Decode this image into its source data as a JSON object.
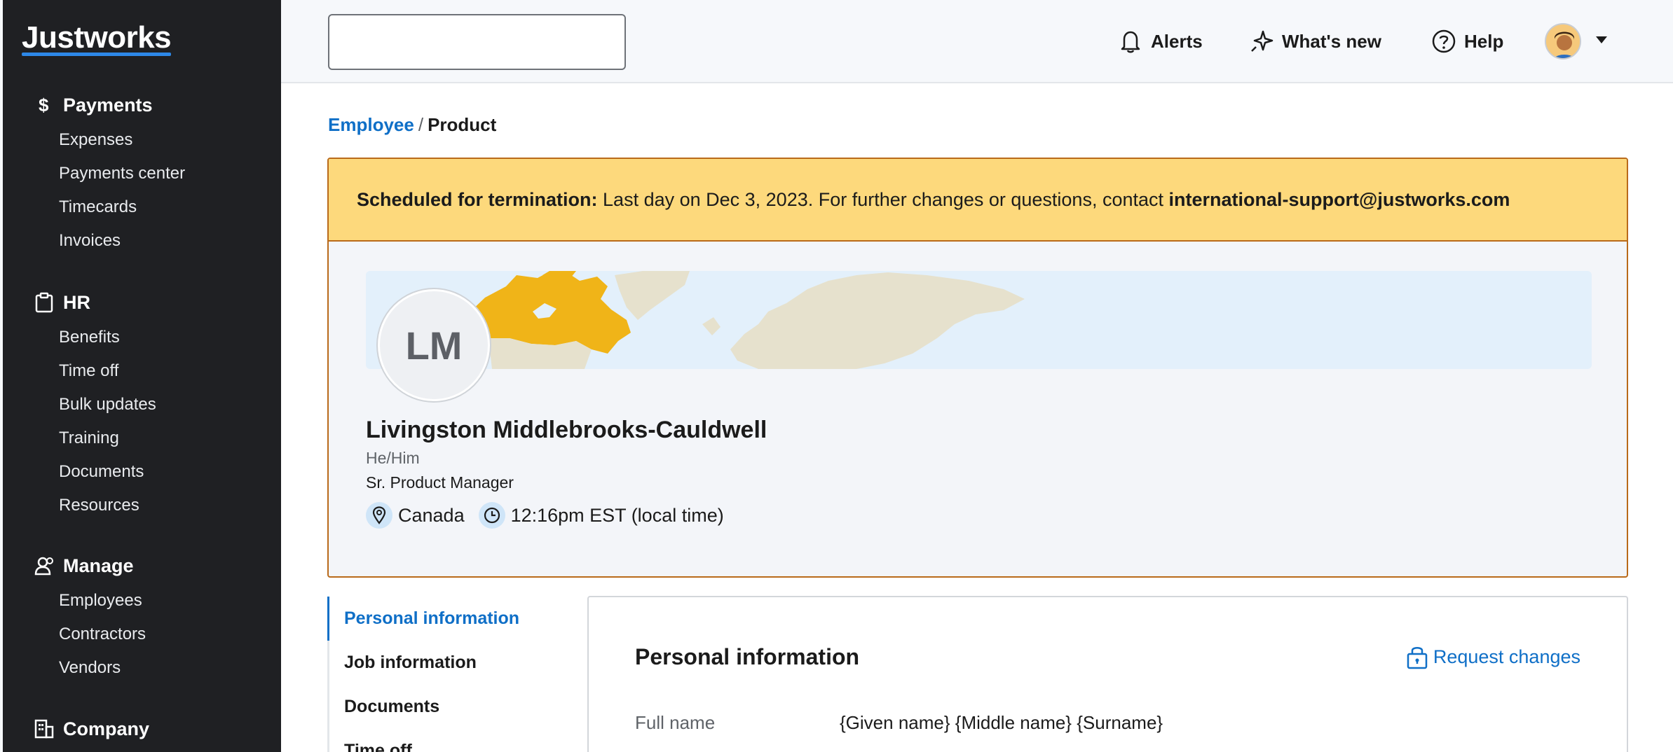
{
  "app": {
    "logo": "Justworks"
  },
  "sidebar": {
    "sections": [
      {
        "title": "Payments",
        "icon": "dollar-icon",
        "items": [
          "Expenses",
          "Payments center",
          "Timecards",
          "Invoices"
        ]
      },
      {
        "title": "HR",
        "icon": "clipboard-icon",
        "items": [
          "Benefits",
          "Time off",
          "Bulk updates",
          "Training",
          "Documents",
          "Resources"
        ]
      },
      {
        "title": "Manage",
        "icon": "people-icon",
        "items": [
          "Employees",
          "Contractors",
          "Vendors"
        ]
      },
      {
        "title": "Company",
        "icon": "building-icon",
        "items": []
      }
    ]
  },
  "topbar": {
    "search_value": "",
    "alerts_label": "Alerts",
    "whats_new_label": "What's new",
    "help_label": "Help"
  },
  "breadcrumb": {
    "parent": "Employee",
    "separator": "/",
    "current": "Product"
  },
  "banner": {
    "label": "Scheduled for termination:",
    "message": " Last day on Dec 3, 2023. For further changes or questions, contact ",
    "email": "international-support@justworks.com"
  },
  "profile": {
    "initials": "LM",
    "name": "Livingston Middlebrooks-Cauldwell",
    "pronouns": "He/Him",
    "title": "Sr. Product Manager",
    "location": "Canada",
    "local_time": "12:16pm EST (local time)"
  },
  "subnav": {
    "items": [
      "Personal information",
      "Job information",
      "Documents",
      "Time off"
    ],
    "active": "Personal information"
  },
  "personal_info": {
    "title": "Personal information",
    "request_label": "Request changes",
    "fields": [
      {
        "label": "Full name",
        "value": "{Given name} {Middle name} {Surname}"
      }
    ]
  },
  "colors": {
    "sidebar_bg": "#1f2023",
    "accent_blue": "#0f6fc7",
    "banner_bg": "#fdd97c",
    "banner_border": "#b96a1a",
    "map_highlight": "#f0b418"
  }
}
